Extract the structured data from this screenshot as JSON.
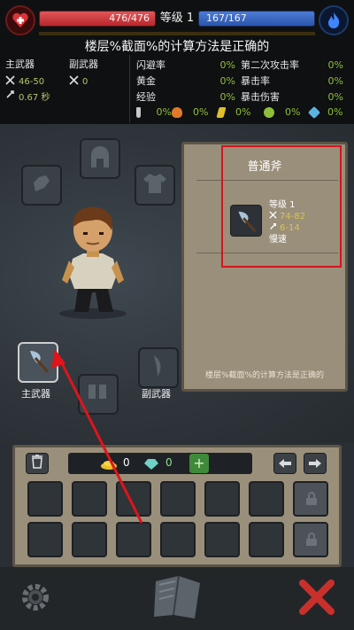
{
  "hud": {
    "hp_text": "476/476",
    "mp_text": "167/167",
    "level_label": "等级 1",
    "title": "楼层%截面%的计算方法是正确的"
  },
  "weapons": {
    "main_header": "主武器",
    "sub_header": "副武器",
    "main_attack": "46-50",
    "main_speed": "0.67 秒",
    "sub_attack": "0"
  },
  "stats": [
    {
      "label": "闪避率",
      "value": "0%",
      "label2": "第二次攻击率",
      "value2": "0%"
    },
    {
      "label": "黄金",
      "value": "0%",
      "label2": "暴击率",
      "value2": "0%"
    },
    {
      "label": "经验",
      "value": "0%",
      "label2": "暴击伤害",
      "value2": "0%"
    }
  ],
  "resists": [
    {
      "icon": "shield-icon",
      "value": "0%",
      "color": "#c8c8c8"
    },
    {
      "icon": "fire-icon",
      "value": "0%",
      "color": "#e07a2a"
    },
    {
      "icon": "lightning-icon",
      "value": "0%",
      "color": "#e0c02a"
    },
    {
      "icon": "poison-icon",
      "value": "0%",
      "color": "#8fbf3a"
    },
    {
      "icon": "frost-icon",
      "value": "0%",
      "color": "#5ab4e0"
    }
  ],
  "equipment": {
    "main_slot_label": "主武器",
    "sub_slot_label": "副武器"
  },
  "item_panel": {
    "name": "普通斧",
    "level": "等级 1",
    "damage": "74-82",
    "crit": "6-14",
    "speed": "慢速",
    "footer": "楼层%截面%的计算方法是正确的"
  },
  "inventory": {
    "gold": "0",
    "gems": "0"
  },
  "colors": {
    "highlight_box": "#d4141b",
    "arrow": "#e0141a"
  }
}
